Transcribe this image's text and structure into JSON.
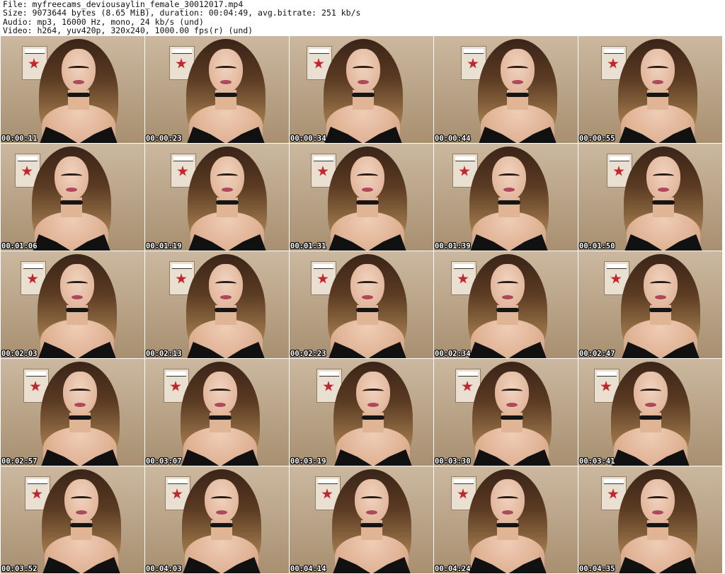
{
  "header": {
    "file_line": "File: myfreecams_deviousaylin_female_30012017.mp4",
    "size_line": "Size: 9073644 bytes (8.65 MiB), duration: 00:04:49, avg.bitrate: 251 kb/s",
    "audio_line": "Audio: mp3, 16000 Hz, mono, 24 kb/s (und)",
    "video_line": "Video: h264, yuv420p, 320x240, 1000.00 fps(r) (und)"
  },
  "thumbnails": [
    {
      "timestamp": "00:00:11"
    },
    {
      "timestamp": "00:00:23"
    },
    {
      "timestamp": "00:00:34"
    },
    {
      "timestamp": "00:00:44"
    },
    {
      "timestamp": "00:00:55"
    },
    {
      "timestamp": "00:01:06"
    },
    {
      "timestamp": "00:01:19"
    },
    {
      "timestamp": "00:01:31"
    },
    {
      "timestamp": "00:01:39"
    },
    {
      "timestamp": "00:01:50"
    },
    {
      "timestamp": "00:02:03"
    },
    {
      "timestamp": "00:02:13"
    },
    {
      "timestamp": "00:02:23"
    },
    {
      "timestamp": "00:02:34"
    },
    {
      "timestamp": "00:02:47"
    },
    {
      "timestamp": "00:02:57"
    },
    {
      "timestamp": "00:03:07"
    },
    {
      "timestamp": "00:03:19"
    },
    {
      "timestamp": "00:03:30"
    },
    {
      "timestamp": "00:03:41"
    },
    {
      "timestamp": "00:03:52"
    },
    {
      "timestamp": "00:04:03"
    },
    {
      "timestamp": "00:04:14"
    },
    {
      "timestamp": "00:04:24"
    },
    {
      "timestamp": "00:04:35"
    }
  ],
  "colors": {
    "background": "#ffffff",
    "header_text": "#111111",
    "timestamp_text": "#ffffff",
    "timestamp_outline": "#000000"
  }
}
